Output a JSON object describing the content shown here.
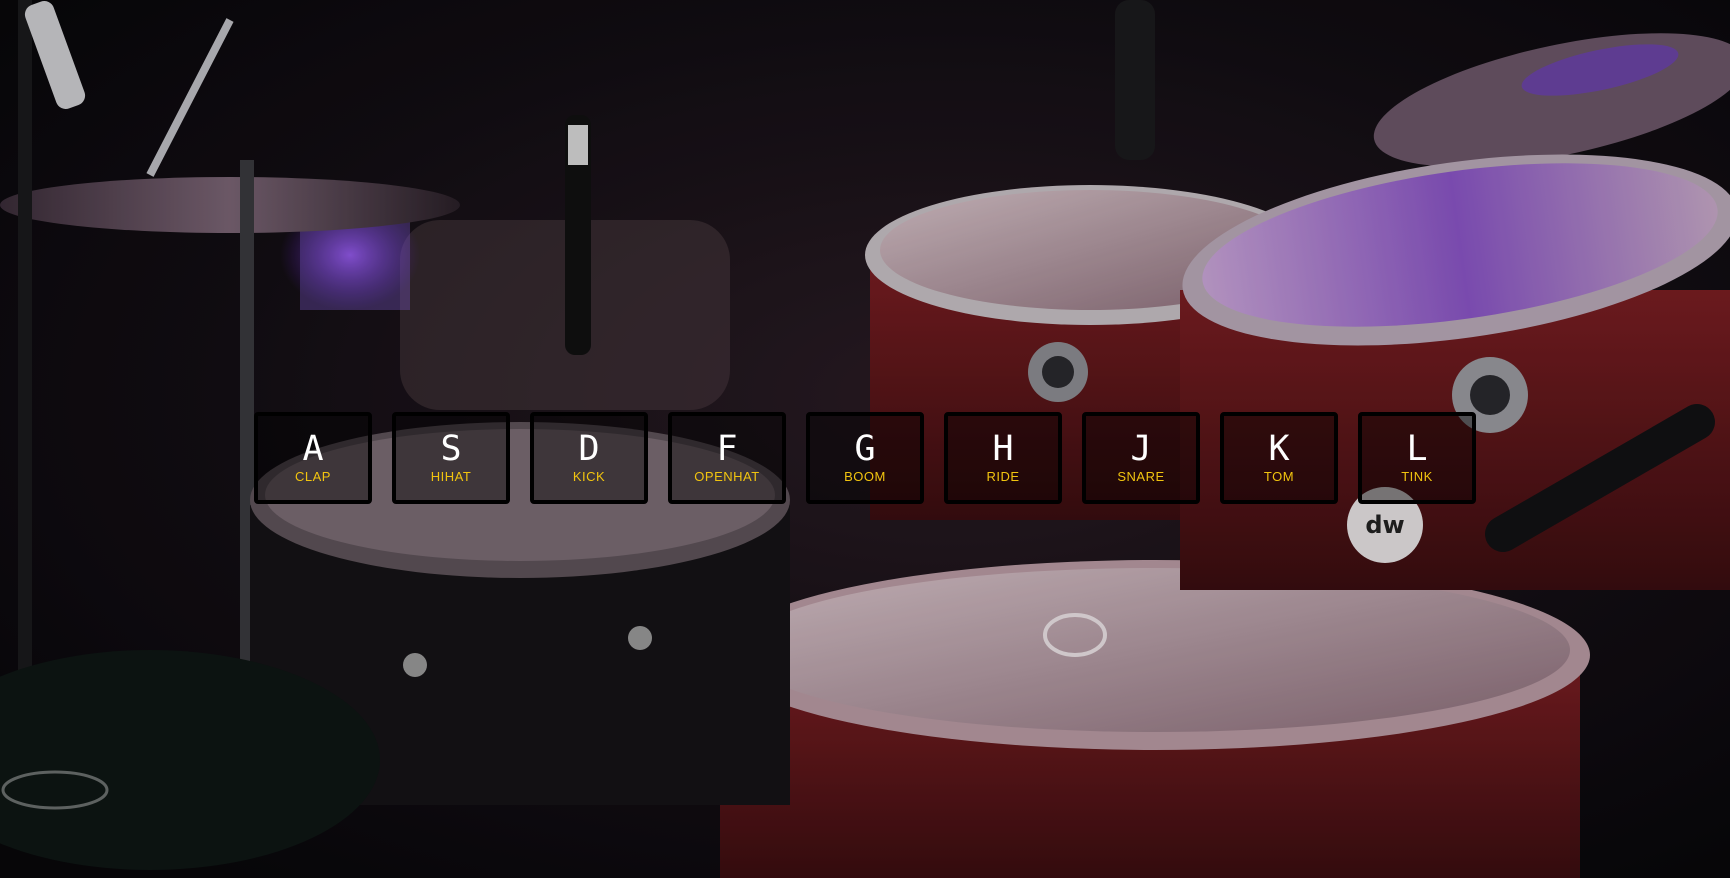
{
  "colors": {
    "key_letter": "#ffffff",
    "sound_label": "#f1c40f",
    "key_border": "#000000"
  },
  "background": {
    "subject": "drum kit photograph"
  },
  "keys": [
    {
      "key": "A",
      "sound": "CLAP"
    },
    {
      "key": "S",
      "sound": "HIHAT"
    },
    {
      "key": "D",
      "sound": "KICK"
    },
    {
      "key": "F",
      "sound": "OPENHAT"
    },
    {
      "key": "G",
      "sound": "BOOM"
    },
    {
      "key": "H",
      "sound": "RIDE"
    },
    {
      "key": "J",
      "sound": "SNARE"
    },
    {
      "key": "K",
      "sound": "TOM"
    },
    {
      "key": "L",
      "sound": "TINK"
    }
  ]
}
